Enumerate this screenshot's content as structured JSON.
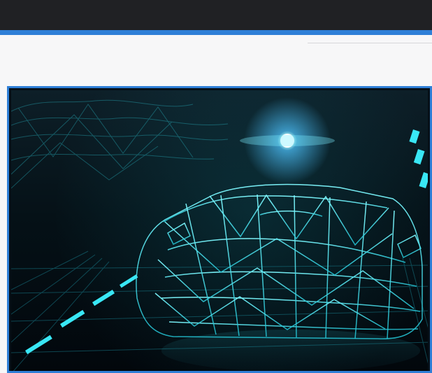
{
  "header": {
    "bar_color": "#202124",
    "accent_color": "#2f7fd7"
  },
  "hero_image": {
    "subject": "wireframe car",
    "theme_color": "#32d5e4"
  }
}
